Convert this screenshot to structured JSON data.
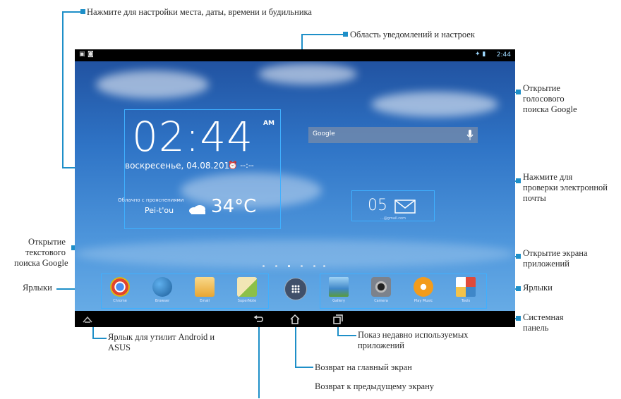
{
  "callouts": {
    "settings_area": "Нажмите для настройки места, даты, времени и будильника",
    "notification_area": "Область уведомлений и настроек",
    "voice_search_1": "Открытие",
    "voice_search_2": "голосового",
    "voice_search_3": "поиска Google",
    "check_email_1": "Нажмите для",
    "check_email_2": "проверки электронной",
    "check_email_3": "почты",
    "text_search_1": "Открытие",
    "text_search_2": "текстового",
    "text_search_3": "поиска Google",
    "apps_screen_1": "Открытие экрана",
    "apps_screen_2": "приложений",
    "shortcuts_left": "Ярлыки",
    "shortcuts_right": "Ярлыки",
    "system_bar_1": "Системная",
    "system_bar_2": "панель",
    "utilities_1": "Ярлык для утилит Android и",
    "utilities_2": "ASUS",
    "recent_apps_1": "Показ недавно используемых",
    "recent_apps_2": "приложений",
    "home": "Возврат на главный экран",
    "back": "Возврат к предыдущему экрану"
  },
  "screen": {
    "status_time": "2:44",
    "clock": {
      "time": "02:44",
      "ampm": "AM",
      "date": "воскресенье, 04.08.2013",
      "alarm": "⏰ --:--",
      "weather_condition": "Облачно с прояснениями",
      "city": "Pei-t'ou",
      "temperature": "34°C"
    },
    "google_label": "Google",
    "mail": {
      "count": "05",
      "caption": "...@gmail.com"
    },
    "apps_left": [
      {
        "label": "Chrome",
        "color": "#e0442f",
        "icon": "chrome-icon"
      },
      {
        "label": "Browser",
        "color": "#2c7ab8",
        "icon": "globe-icon"
      },
      {
        "label": "Email",
        "color": "#f3c34a",
        "icon": "email-icon"
      },
      {
        "label": "SuperNote",
        "color": "#8cc04a",
        "icon": "notes-icon"
      }
    ],
    "apps_right": [
      {
        "label": "Gallery",
        "color": "#3f87c8",
        "icon": "gallery-icon"
      },
      {
        "label": "Camera",
        "color": "#8a8f98",
        "icon": "camera-icon"
      },
      {
        "label": "Play Music",
        "color": "#f39c1c",
        "icon": "music-icon"
      },
      {
        "label": "Tools",
        "color": "#e04a3a",
        "icon": "tools-folder-icon"
      }
    ]
  }
}
